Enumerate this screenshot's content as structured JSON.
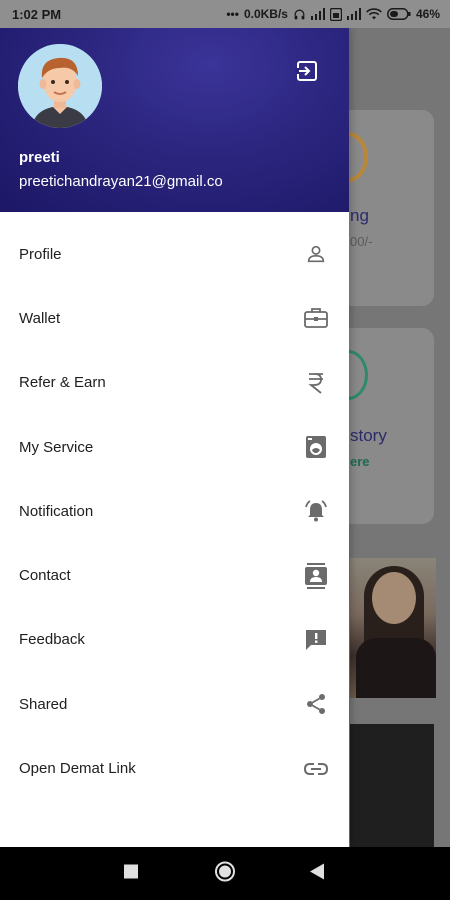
{
  "status_bar": {
    "time": "1:02 PM",
    "network_speed": "0.0KB/s",
    "battery": "46%"
  },
  "background": {
    "card1_title": "ng",
    "card1_sub": "00/-",
    "card2_title": "story",
    "card2_link": "ere"
  },
  "drawer": {
    "user": {
      "name": "preeti",
      "email": "preetichandrayan21@gmail.co"
    },
    "menu": [
      {
        "label": "Profile",
        "icon": "person-outline-icon"
      },
      {
        "label": "Wallet",
        "icon": "briefcase-icon"
      },
      {
        "label": "Refer & Earn",
        "icon": "rupee-icon"
      },
      {
        "label": "My Service",
        "icon": "washing-machine-icon"
      },
      {
        "label": "Notification",
        "icon": "alarm-bell-icon"
      },
      {
        "label": "Contact",
        "icon": "contacts-icon"
      },
      {
        "label": "Feedback",
        "icon": "feedback-icon"
      },
      {
        "label": "Shared",
        "icon": "share-icon"
      },
      {
        "label": "Open Demat Link",
        "icon": "link-icon"
      }
    ]
  },
  "colors": {
    "header": "#2b257e",
    "icon": "#6b6b6b",
    "text": "#202020"
  }
}
